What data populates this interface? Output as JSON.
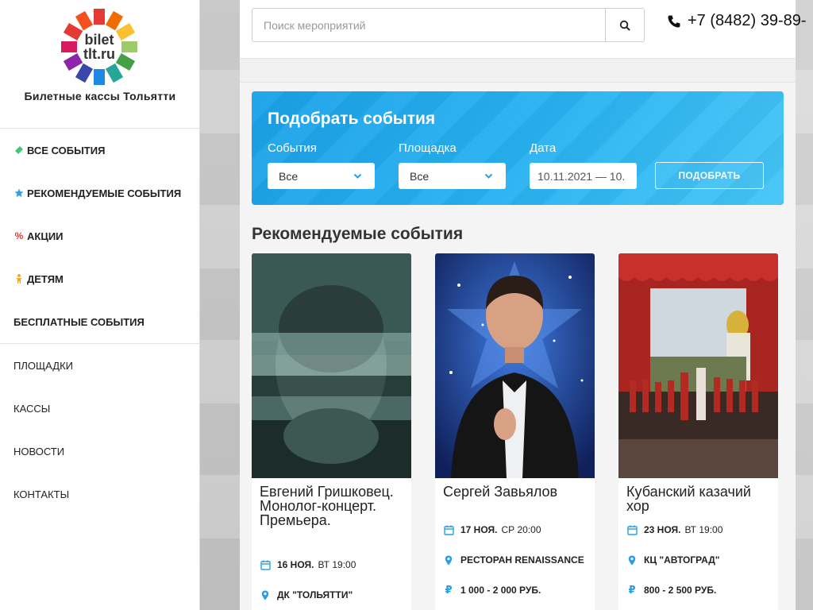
{
  "brand": {
    "logo_line1": "bilet",
    "logo_line2": "tlt.ru",
    "caption": "Билетные кассы Тольятти"
  },
  "sidebar": {
    "items": [
      {
        "label": "Все события",
        "icon": "ticket-icon"
      },
      {
        "label": "Рекомендуемые события",
        "icon": "star-icon"
      },
      {
        "label": "Акции",
        "icon": "percent-icon"
      },
      {
        "label": "Детям",
        "icon": "child-icon"
      },
      {
        "label": "Бесплатные события"
      },
      {
        "label": "Площадки"
      },
      {
        "label": "Кассы"
      },
      {
        "label": "Новости"
      },
      {
        "label": "Контакты"
      }
    ]
  },
  "header": {
    "search_placeholder": "Поиск мероприятий",
    "phone": "+7 (8482) 39-89-"
  },
  "filter": {
    "title": "Подобрать события",
    "events_label": "События",
    "events_value": "Все",
    "venue_label": "Площадка",
    "venue_value": "Все",
    "date_label": "Дата",
    "date_value": "10.11.2021 — 10.",
    "submit_label": "ПОДОБРАТЬ"
  },
  "recommended": {
    "title": "Рекомендуемые события",
    "cards": [
      {
        "title": "Евгений Гришковец. Монолог-концерт. Премьера.",
        "date": "16 ноя.",
        "time": "вт 19:00",
        "venue": "ДК \"Тольятти\"",
        "price": ""
      },
      {
        "title": "Сергей Завьялов",
        "date": "17 ноя.",
        "time": "ср 20:00",
        "venue": "Ресторан Renaissance",
        "price": "1 000 - 2 000 руб."
      },
      {
        "title": "Кубанский казачий хор",
        "date": "23 ноя.",
        "time": "вт 19:00",
        "venue": "КЦ \"Автоград\"",
        "price": "800 - 2 500 руб."
      }
    ]
  },
  "colors": {
    "accent": "#2b9fe6",
    "filter_bg": "#1aa1e8"
  }
}
